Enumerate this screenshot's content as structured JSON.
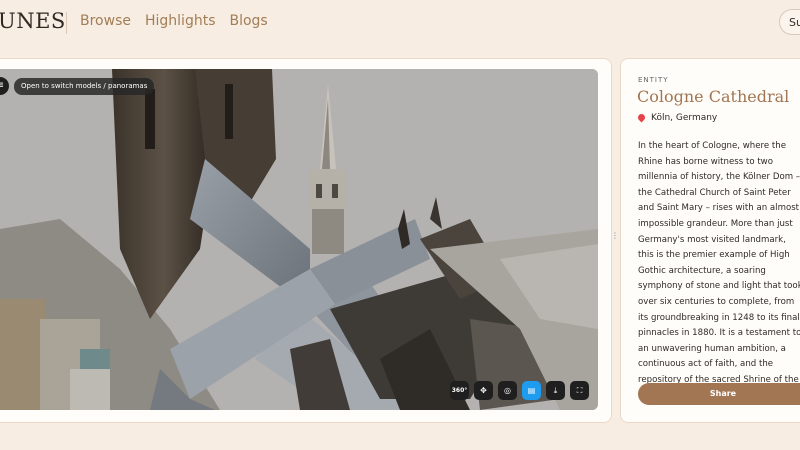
{
  "header": {
    "logo": "UNES",
    "nav": [
      "Browse",
      "Highlights",
      "Blogs"
    ],
    "button_label": "Su"
  },
  "viewer": {
    "layers_icon": "layers-icon",
    "tooltip": "Open to switch models / panoramas",
    "toolbar": [
      {
        "name": "360-view-icon",
        "label": "360°",
        "active": false
      },
      {
        "name": "navigate-icon",
        "label": "✥",
        "active": false
      },
      {
        "name": "camera-icon",
        "label": "◎",
        "active": false
      },
      {
        "name": "document-icon",
        "label": "▤",
        "active": true
      },
      {
        "name": "download-icon",
        "label": "⤓",
        "active": false
      },
      {
        "name": "fullscreen-icon",
        "label": "⛶",
        "active": false
      }
    ]
  },
  "info": {
    "label": "ENTITY",
    "title": "Cologne Cathedral",
    "location": "Köln, Germany",
    "description": "In the heart of Cologne, where the Rhine has borne witness to two millennia of history, the Kölner Dom – the Cathedral Church of Saint Peter and Saint Mary – rises with an almost impossible grandeur. More than just Germany's most visited landmark, this is the premier example of High Gothic architecture, a soaring symphony of stone and light that took over six centuries to complete, from its groundbreaking in 1248 to its final pinnacles in 1880. It is a testament to an unwavering human ambition, a continuous act of faith, and the repository of the sacred Shrine of the",
    "share_label": "Share"
  },
  "colors": {
    "accent": "#a27553",
    "background": "#f8ede3",
    "active_tool": "#1e9cf0"
  }
}
